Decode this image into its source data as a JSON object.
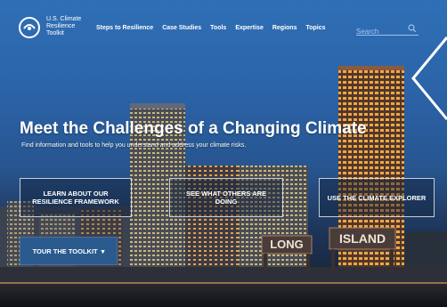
{
  "logo": {
    "line1": "U.S. Climate",
    "line2": "Resilience",
    "line3": "Toolkit"
  },
  "nav": {
    "items": [
      {
        "label": "Steps to Resilience"
      },
      {
        "label": "Case Studies"
      },
      {
        "label": "Tools"
      },
      {
        "label": "Expertise"
      },
      {
        "label": "Regions"
      },
      {
        "label": "Topics"
      }
    ]
  },
  "search": {
    "placeholder": "Search"
  },
  "hero": {
    "headline": "Meet the Challenges of a Changing Climate",
    "subhead": "Find information and tools to help you understand and address your climate risks."
  },
  "ctas": [
    {
      "label": "LEARN ABOUT OUR RESILIENCE FRAMEWORK"
    },
    {
      "label": "SEE WHAT OTHERS ARE DOING"
    },
    {
      "label": "USE THE CLIMATE EXPLORER"
    }
  ],
  "tour": {
    "label": "TOUR THE TOOLKIT",
    "arrow": "▾"
  },
  "signs": {
    "sign1": "LONG",
    "sign2": "ISLAND"
  },
  "colors": {
    "sky_top": "#2f6fb6",
    "sky_bottom": "#141c28",
    "tour_bg": "#2a5a8e",
    "accent": "#9cc3f0"
  }
}
